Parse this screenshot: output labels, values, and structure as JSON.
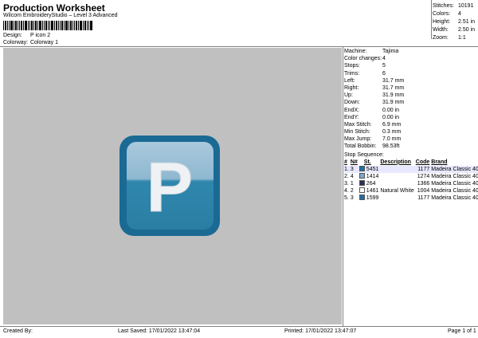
{
  "header": {
    "title": "Production Worksheet",
    "subtitle": "Wilcom EmbroideryStudio – Level 3 Advanced",
    "design_label": "Design:",
    "design_value": "P icon 2",
    "colorway_label": "Colorway:",
    "colorway_value": "Colorway 1"
  },
  "stats": [
    {
      "label": "Stitches:",
      "value": "10191"
    },
    {
      "label": "Colors:",
      "value": "4"
    },
    {
      "label": "Height:",
      "value": "2.51 in"
    },
    {
      "label": "Width:",
      "value": "2.50 in"
    },
    {
      "label": "Zoom:",
      "value": "1:1"
    }
  ],
  "info": [
    {
      "label": "Machine:",
      "value": "Tajima"
    },
    {
      "label": "Color changes:",
      "value": "4"
    },
    {
      "label": "Stops:",
      "value": "5"
    },
    {
      "label": "Trims:",
      "value": "6"
    },
    {
      "label": "Left:",
      "value": "31.7 mm"
    },
    {
      "label": "Right:",
      "value": "31.7 mm"
    },
    {
      "label": "Up:",
      "value": "31.9 mm"
    },
    {
      "label": "Down:",
      "value": "31.9 mm"
    },
    {
      "label": "EndX:",
      "value": "0.00 in"
    },
    {
      "label": "EndY:",
      "value": "0.00 in"
    },
    {
      "label": "Max Stitch:",
      "value": "6.9 mm"
    },
    {
      "label": "Min Stitch:",
      "value": "0.3 mm"
    },
    {
      "label": "Max Jump:",
      "value": "7.0 mm"
    },
    {
      "label": "Total Bobbin:",
      "value": "98.53ft"
    }
  ],
  "stop_sequence": {
    "title": "Stop Sequence:",
    "headers": [
      "#",
      "N#",
      "St.",
      "Description",
      "Code",
      "Brand"
    ],
    "rows": [
      {
        "num": "1.",
        "n": "3",
        "swatch": "#1f6ea6",
        "st": "5451",
        "desc": "",
        "code": "1177",
        "brand": "Madeira Classic 40"
      },
      {
        "num": "2.",
        "n": "4",
        "swatch": "#7aa9c9",
        "st": "1414",
        "desc": "",
        "code": "1274",
        "brand": "Madeira Classic 40"
      },
      {
        "num": "3.",
        "n": "1",
        "swatch": "#2b2f5a",
        "st": "264",
        "desc": "",
        "code": "1366",
        "brand": "Madeira Classic 40"
      },
      {
        "num": "4.",
        "n": "2",
        "swatch": "#ffffff",
        "st": "1461",
        "desc": "Natural White",
        "code": "1004",
        "brand": "Madeira Classic 40"
      },
      {
        "num": "5.",
        "n": "3",
        "swatch": "#1f6ea6",
        "st": "1599",
        "desc": "",
        "code": "1177",
        "brand": "Madeira Classic 40"
      }
    ]
  },
  "footer": {
    "created_by": "Created By:",
    "last_saved": "Last Saved: 17/01/2022 13:47:04",
    "printed": "Printed: 17/01/2022 13:47:07",
    "page": "Page 1 of 1"
  },
  "design_preview": {
    "letter": "P",
    "icon_colors": {
      "outer": "#1a6a94",
      "inner": "#2f87ad",
      "letter": "#eef2f5",
      "canvas": "#c0c0c0"
    }
  }
}
